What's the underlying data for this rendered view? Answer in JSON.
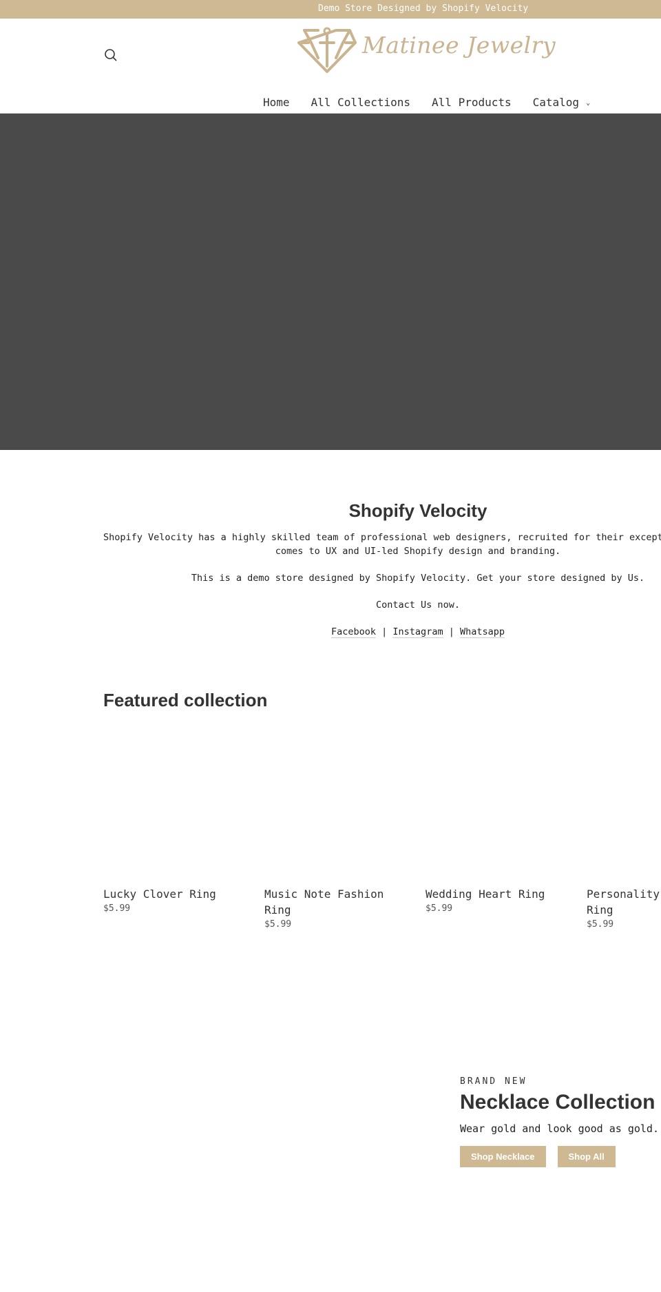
{
  "announcement": "Demo Store Designed by Shopify Velocity",
  "header": {
    "logo_text": "Matinee Jewelry",
    "brand_color": "#cfb993",
    "search_icon": "search-icon"
  },
  "nav": {
    "items": [
      {
        "label": "Home"
      },
      {
        "label": "All Collections"
      },
      {
        "label": "All Products"
      },
      {
        "label": "Catalog",
        "icon": "chevron-down-icon"
      }
    ],
    "chevron": "⌄"
  },
  "hero": {
    "background": "#4a4a4a"
  },
  "about": {
    "title": "Shopify Velocity",
    "paragraph1_line1": "Shopify Velocity has a highly skilled team of professional web designers, recruited for their exceptional skills when it",
    "paragraph1_line2": "comes to UX and UI-led Shopify design and branding.",
    "paragraph2": "This is a demo store designed by Shopify Velocity. Get your store designed by Us.",
    "paragraph3": "Contact Us now.",
    "links": [
      {
        "label": "Facebook"
      },
      {
        "label": "Instagram"
      },
      {
        "label": "Whatsapp"
      }
    ],
    "separator": "|"
  },
  "featured": {
    "title": "Featured collection",
    "products": [
      {
        "title": "Lucky Clover Ring",
        "price": "$5.99"
      },
      {
        "title": "Music Note Fashion Ring",
        "price": "$5.99"
      },
      {
        "title": "Wedding Heart Ring",
        "price": "$5.99"
      },
      {
        "title": "Personality Ring",
        "price": "$5.99"
      }
    ]
  },
  "promo": {
    "kicker": "BRAND NEW",
    "title": "Necklace Collection",
    "description": "Wear gold and look good as gold. Bring out the best in you.",
    "buttons": [
      {
        "label": "Shop Necklace"
      },
      {
        "label": "Shop All"
      }
    ]
  }
}
